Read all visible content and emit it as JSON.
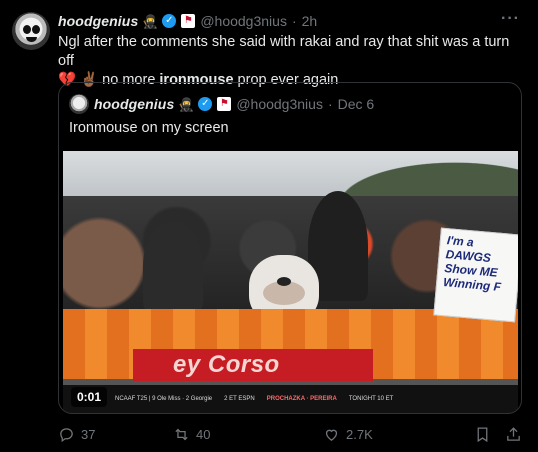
{
  "author": {
    "name": "hoodgenius",
    "badges": [
      "ninja-icon",
      "verified-icon",
      "flag-icon"
    ],
    "handle": "@hoodg3nius",
    "separator": "·",
    "time": "2h"
  },
  "more_label": "···",
  "tweet_text": {
    "line1": "Ngl after the comments she said with rakai and ray that shit was a turn off",
    "emoji1": "💔",
    "emoji2": "✌🏾",
    "line2_pre": " no more ",
    "line2_bold": "ironmouse",
    "line2_post": " prop ever again"
  },
  "quote": {
    "name": "hoodgenius",
    "handle": "@hoodg3nius",
    "separator": "·",
    "time": "Dec 6",
    "text": "Ironmouse on my screen"
  },
  "video": {
    "timer": "0:01",
    "banner": "ey Corso",
    "sign_lines": [
      "I'm a",
      "DAWGS",
      "Show ME",
      "Winning F"
    ],
    "ticker": [
      "NCAAF T25 | 9 Ole Miss · 2 Georgie",
      "2 ET ESPN",
      "PROCHAZKA · PEREIRA",
      "TONIGHT 10 ET"
    ]
  },
  "actions": {
    "replies": "37",
    "retweets": "40",
    "likes": "2.7K"
  },
  "colors": {
    "background": "#000000",
    "text": "#e7e9ea",
    "muted": "#71767b",
    "border": "#2f3336",
    "verified": "#1d9bf0"
  }
}
